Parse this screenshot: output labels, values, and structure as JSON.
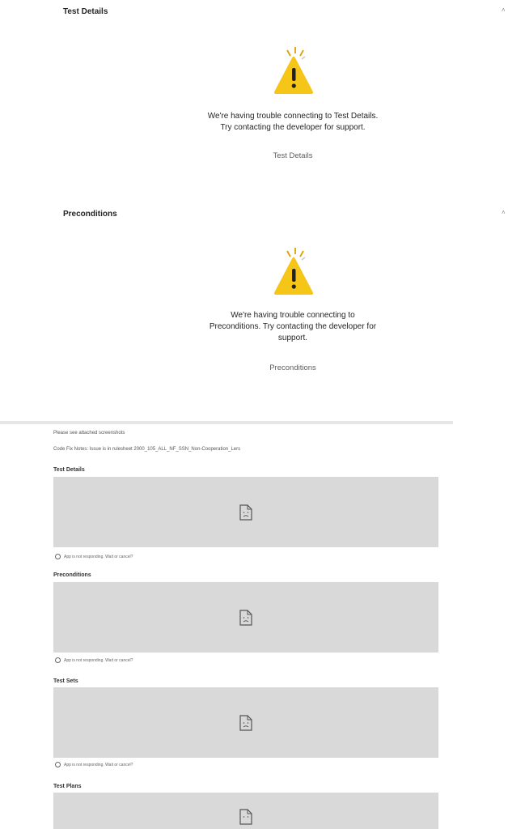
{
  "sections": [
    {
      "title": "Test Details",
      "message_lines": [
        "We're having trouble connecting to Test Details.",
        "Try contacting the developer for support."
      ],
      "app_name": "Test Details"
    },
    {
      "title": "Preconditions",
      "message_lines": [
        "We're having trouble connecting to",
        "Preconditions. Try contacting the developer for",
        "support."
      ],
      "app_name": "Preconditions"
    }
  ],
  "embedded": {
    "attach_note": "Please see attached screenshots",
    "code_fix_note": "Code Fix Notes: Issue is in rulesheet 2000_105_ALL_NF_SSN_Non-Cooperation_Lers",
    "blocks": [
      {
        "title": "Test Details",
        "status": "App is not responding. Wait or cancel?"
      },
      {
        "title": "Preconditions",
        "status": "App is not responding. Wait or cancel?"
      },
      {
        "title": "Test Sets",
        "status": "App is not responding. Wait or cancel?"
      },
      {
        "title": "Test Plans",
        "status": ""
      }
    ]
  },
  "colors": {
    "warning": "#F5C518",
    "spark": "#E0A000",
    "placeholder_bg": "#D9D9D9"
  },
  "icons": {
    "warning": "warning-icon",
    "broken_doc": "broken-document-icon",
    "chevron": "chevron-up-icon",
    "spinner": "spinner-icon"
  }
}
